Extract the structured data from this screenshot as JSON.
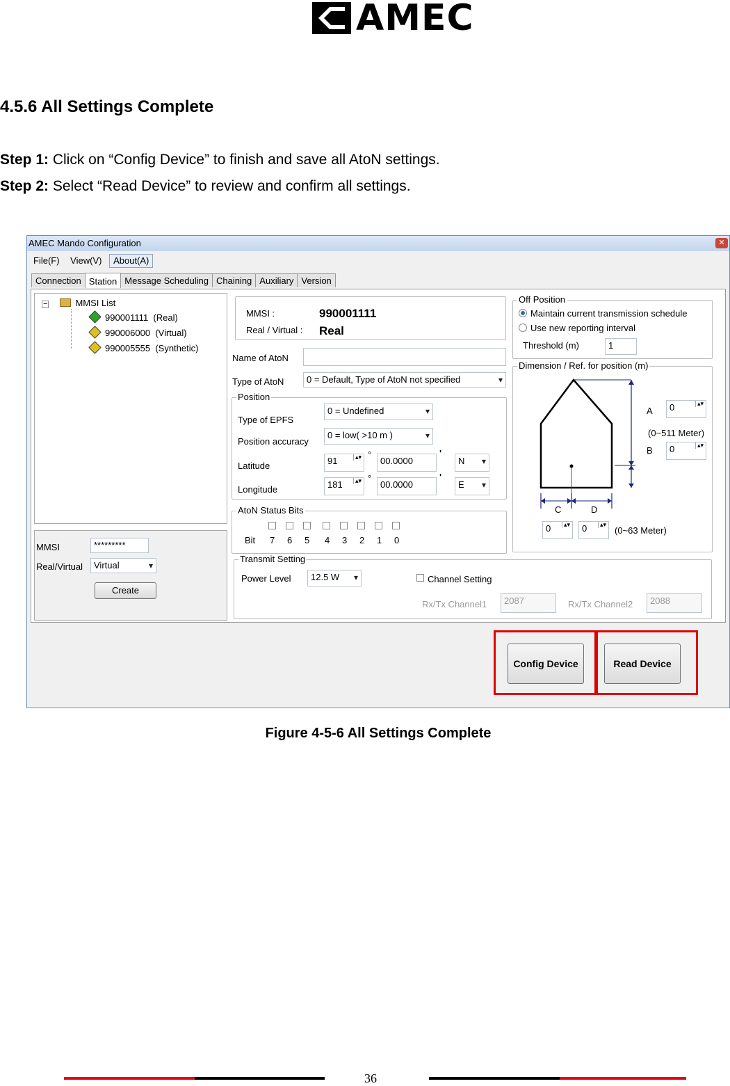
{
  "header": {
    "logo_text": "AMEC"
  },
  "section_title": "4.5.6 All Settings Complete",
  "steps": [
    {
      "label": "Step 1:",
      "text": " Click on “Config Device” to finish and save all AtoN settings."
    },
    {
      "label": "Step 2:",
      "text": " Select “Read Device” to review and confirm all settings."
    }
  ],
  "window": {
    "title": "AMEC Mando Configuration",
    "menu": [
      "File(F)",
      "View(V)",
      "About(A)"
    ],
    "tabs": [
      "Connection",
      "Station",
      "Message Scheduling",
      "Chaining",
      "Auxiliary",
      "Version"
    ],
    "tree": {
      "root": "MMSI List",
      "items": [
        {
          "mmsi": "990001111",
          "kind": "(Real)",
          "color": "#2aa52a"
        },
        {
          "mmsi": "990006000",
          "kind": "(Virtual)",
          "color": "#e0c020"
        },
        {
          "mmsi": "990005555",
          "kind": "(Synthetic)",
          "color": "#e0c020"
        }
      ]
    },
    "left_form": {
      "mmsi_label": "MMSI",
      "mmsi_value": "*********",
      "real_virtual_label": "Real/Virtual",
      "real_virtual_value": "Virtual",
      "create_button": "Create"
    },
    "info": {
      "mmsi_label": "MMSI :",
      "mmsi_value": "990001111",
      "rv_label": "Real / Virtual :",
      "rv_value": "Real"
    },
    "name_of_aton_label": "Name of AtoN",
    "name_of_aton_value": "",
    "type_of_aton_label": "Type of AtoN",
    "type_of_aton_value": "0 = Default, Type of AtoN not specified",
    "position": {
      "legend": "Position",
      "epfs_label": "Type of EPFS",
      "epfs_value": "0 = Undefined",
      "accuracy_label": "Position accuracy",
      "accuracy_value": "0 = low( >10 m )",
      "lat_label": "Latitude",
      "lat_deg": "91",
      "lat_min": "00.0000",
      "lat_dir": "N",
      "lon_label": "Longitude",
      "lon_deg": "181",
      "lon_min": "00.0000",
      "lon_dir": "E",
      "deg_symbol": "°",
      "min_symbol": "'"
    },
    "status_bits": {
      "legend": "AtoN Status Bits",
      "bit_label": "Bit",
      "bits": [
        "7",
        "6",
        "5",
        "4",
        "3",
        "2",
        "1",
        "0"
      ]
    },
    "transmit": {
      "legend": "Transmit Setting",
      "power_label": "Power Level",
      "power_value": "12.5 W",
      "channel_setting_label": "Channel Setting",
      "ch1_label": "Rx/Tx Channel1",
      "ch1_value": "2087",
      "ch2_label": "Rx/Tx Channel2",
      "ch2_value": "2088"
    },
    "off_position": {
      "legend": "Off Position",
      "opt1": "Maintain current transmission schedule",
      "opt2": "Use new reporting interval",
      "threshold_label": "Threshold (m)",
      "threshold_value": "1"
    },
    "dimension": {
      "legend": "Dimension / Ref. for position (m)",
      "a_label": "A",
      "a_value": "0",
      "b_label": "B",
      "b_value": "0",
      "ab_range": "(0~511 Meter)",
      "c_label": "C",
      "c_value": "0",
      "d_label": "D",
      "d_value": "0",
      "cd_range": "(0~63 Meter)"
    },
    "config_button": "Config Device",
    "read_button": "Read Device"
  },
  "caption": "Figure 4-5-6 All Settings Complete",
  "page_number": "36",
  "colors": {
    "highlight": "#e00000",
    "footer_red": "#e30613",
    "footer_black": "#000000"
  }
}
